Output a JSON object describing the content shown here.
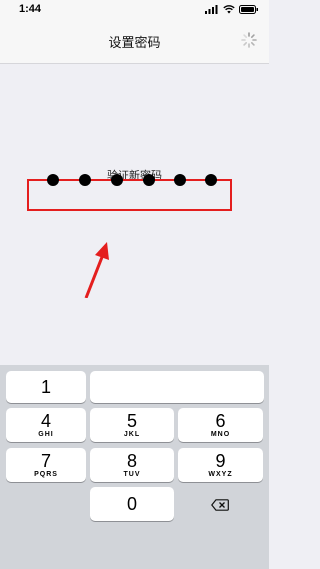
{
  "status": {
    "time": "1:44"
  },
  "nav": {
    "title": "设置密码"
  },
  "prompt": "验证新密码",
  "pin": {
    "filled": 6,
    "length": 6
  },
  "keys": [
    {
      "digit": "1",
      "letters": ""
    },
    {
      "digit": "",
      "letters": ""
    },
    {
      "digit": "4",
      "letters": "GHI"
    },
    {
      "digit": "5",
      "letters": "JKL"
    },
    {
      "digit": "6",
      "letters": "MNO"
    },
    {
      "digit": "7",
      "letters": "PQRS"
    },
    {
      "digit": "8",
      "letters": "TUV"
    },
    {
      "digit": "9",
      "letters": "WXYZ"
    },
    {
      "digit": "0",
      "letters": ""
    }
  ],
  "colors": {
    "highlight": "#e41e1e",
    "background": "#efeff4",
    "keypad": "#d1d4d9"
  },
  "icons": [
    "signal-icon",
    "wifi-icon",
    "battery-icon",
    "loading-spinner-icon",
    "delete-key-icon"
  ]
}
